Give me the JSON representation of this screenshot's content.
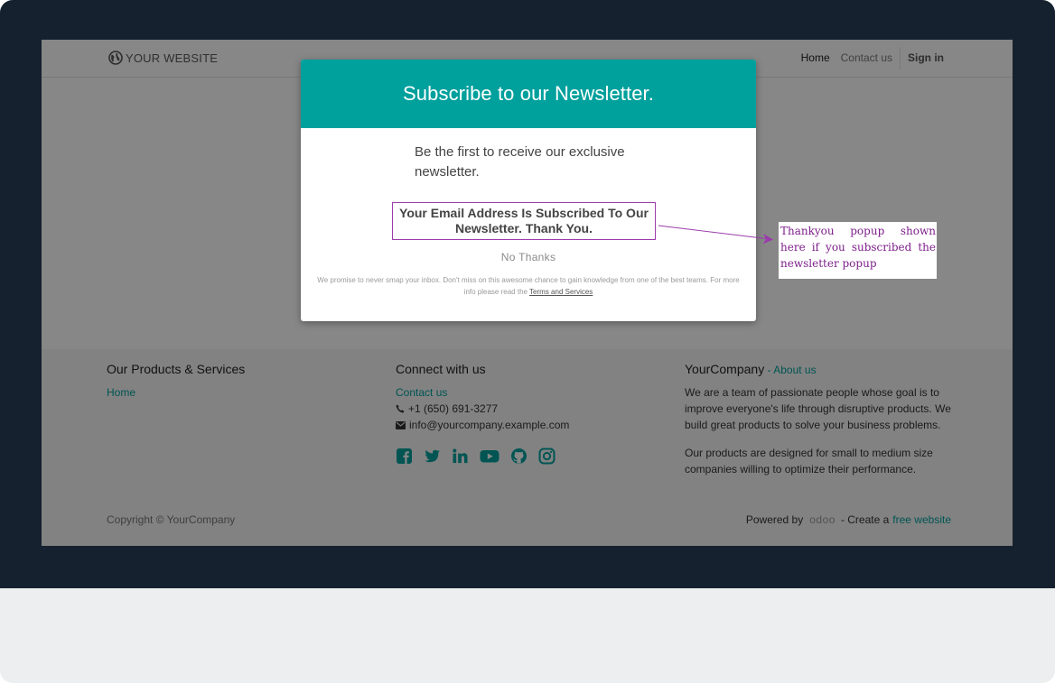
{
  "header": {
    "logo_text": "YOUR WEBSITE",
    "nav": [
      {
        "label": "Home"
      },
      {
        "label": "Contact us"
      },
      {
        "label": "Sign in"
      }
    ]
  },
  "modal": {
    "title": "Subscribe to our Newsletter.",
    "lead": "Be the first to receive our exclusive newsletter.",
    "thanks": "Your Email Address Is Subscribed To Our Newsletter. Thank You.",
    "no_thanks": "No Thanks",
    "fine_print": "We promise to never smap your inbox. Don't miss on this awesome chance to gain knowledge from one of the best teams. For more info please read the",
    "terms_link": "Terms and Services"
  },
  "callout": {
    "text": "Thankyou popup shown here if you subscribed the newsletter popup"
  },
  "footer": {
    "products": {
      "title": "Our Products & Services",
      "link": "Home"
    },
    "connect": {
      "title": "Connect with us",
      "contact_link": "Contact us",
      "phone": "+1 (650) 691-3277",
      "email": "info@yourcompany.example.com",
      "social_icons": [
        "facebook-icon",
        "twitter-icon",
        "linkedin-icon",
        "youtube-icon",
        "github-icon",
        "instagram-icon"
      ]
    },
    "company": {
      "title": "YourCompany",
      "separator": " - ",
      "about_link": "About us",
      "para1": "We are a team of passionate people whose goal is to improve everyone's life through disruptive products. We build great products to solve your business problems.",
      "para2": "Our products are designed for small to medium size companies willing to optimize their performance."
    },
    "copyright": "Copyright © YourCompany",
    "powered_by": "Powered by",
    "odoo_logo": "odoo",
    "create_text": "- Create a",
    "free_website": "free website"
  },
  "colors": {
    "accent": "#00a09d",
    "annotation": "#9b3cab",
    "bezel": "#15212e"
  }
}
